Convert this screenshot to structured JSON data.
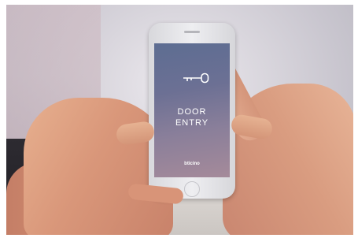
{
  "photo": {
    "scene": "hands holding smartphone",
    "screen": {
      "title_line1": "DOOR",
      "title_line2": "ENTRY",
      "brand": "bticino",
      "icon": "key-icon"
    }
  }
}
